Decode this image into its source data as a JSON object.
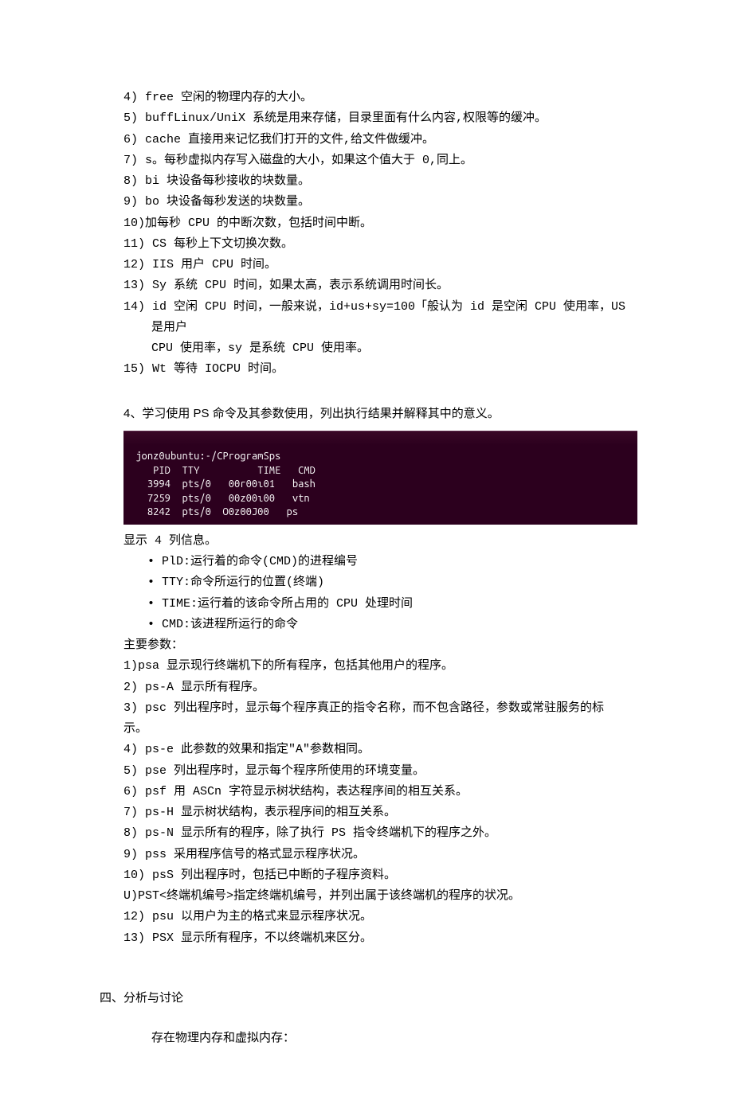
{
  "topList": [
    "4)  free 空闲的物理内存的大小。",
    "5)  buffLinux/UniX 系统是用来存储，目录里面有什么内容,权限等的缓冲。",
    "6)  cache 直接用来记忆我们打开的文件,给文件做缓冲。",
    "7)  s。每秒虚拟内存写入磁盘的大小，如果这个值大于 0,同上。",
    "8)  bi 块设备每秒接收的块数量。",
    "9)  bo 块设备每秒发送的块数量。",
    "10)加每秒 CPU 的中断次数，包括时间中断。",
    "11)  CS 每秒上下文切换次数。",
    "12)  IIS 用户 CPU 时间。",
    "13)  Sy 系统 CPU 时间，如果太高，表示系统调用时间长。",
    "14)  id 空闲 CPU 时间，一般来说，id+us+sy=100「般认为 id 是空闲 CPU 使用率，US 是用户"
  ],
  "topListCont": "CPU 使用率，sy 是系统 CPU 使用率。",
  "topListLast": "15)  Wt 等待 IOCPU 时间。",
  "sectionTitle": "4、学习使用 PS 命令及其参数使用，列出执行结果并解释其中的意义。",
  "terminal": {
    "prompt": " jonz0ubuntu:-/CProgramSps",
    "header": "    PID  TTY          TIME   CMD",
    "rows": [
      "   3994  pts/0   00r00ι01   bash",
      "   7259  pts/0   00z00ι00   vtn",
      "   8242  pts/0  O0z00J00   ps"
    ]
  },
  "afterTerminal": {
    "intro": "显示 4 列信息。",
    "bullets": [
      "•    PlD:运行着的命令(CMD)的进程编号",
      "•    TTY:命令所运行的位置(终端)",
      "•    TIME:运行着的该命令所占用的 CPU 处理时间",
      "•    CMD:该进程所运行的命令"
    ],
    "paramsHeading": "主要参数：",
    "params": [
      "1)psa 显示现行终端机下的所有程序，包括其他用户的程序。",
      "2)  ps-A 显示所有程序。",
      "3)  psc 列出程序时，显示每个程序真正的指令名称，而不包含路径，参数或常驻服务的标",
      "示。",
      "4)  ps-e 此参数的效果和指定\"A\"参数相同。",
      "5)  pse 列出程序时，显示每个程序所使用的环境变量。",
      "6)  psf 用 ASCn 字符显示树状结构，表达程序间的相互关系。",
      "7)  ps-H 显示树状结构，表示程序间的相互关系。",
      "8)  ps-N 显示所有的程序，除了执行 PS 指令终端机下的程序之外。",
      "9)  pss 采用程序信号的格式显示程序状况。",
      "10)  psS 列出程序时，包括已中断的子程序资料。",
      "U)PST<终端机编号>指定终端机编号，并列出属于该终端机的程序的状况。",
      "12)  psu 以用户为主的格式来显示程序状况。",
      "13)  PSX 显示所有程序，不以终端机来区分。"
    ]
  },
  "conclusion": {
    "heading": "四、分析与讨论",
    "body": "存在物理内存和虚拟内存："
  }
}
